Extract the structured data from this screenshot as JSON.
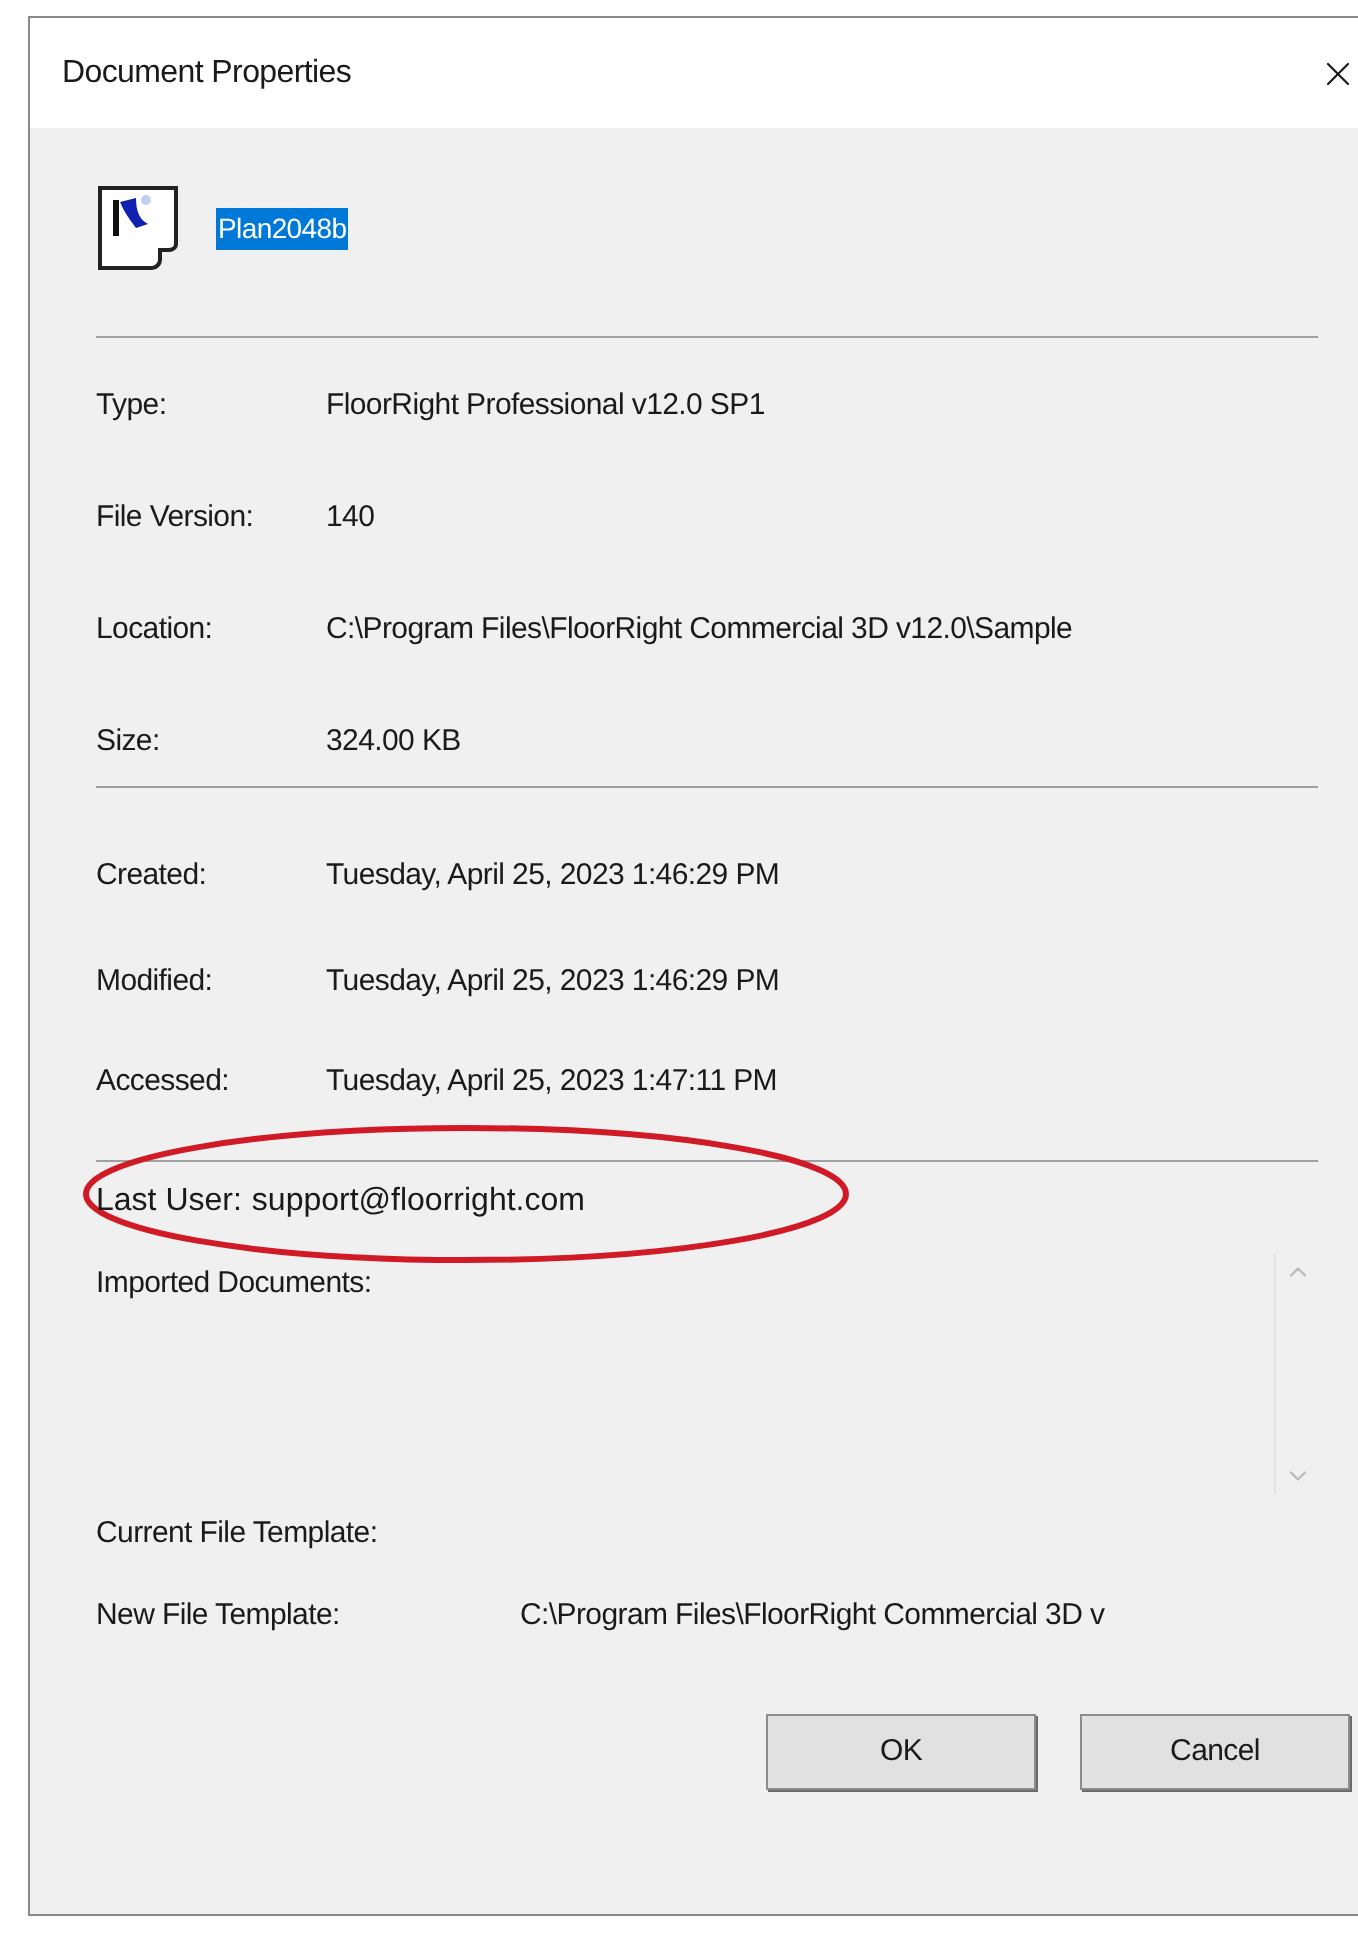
{
  "window": {
    "title": "Document Properties"
  },
  "document": {
    "name": "Plan2048b",
    "selected": true
  },
  "general": [
    {
      "label": "Type:",
      "value": "FloorRight Professional v12.0 SP1"
    },
    {
      "label": "File Version:",
      "value": "140"
    },
    {
      "label": "Location:",
      "value": "C:\\Program Files\\FloorRight Commercial 3D v12.0\\Sample"
    },
    {
      "label": "Size:",
      "value": "324.00 KB"
    }
  ],
  "dates": [
    {
      "label": "Created:",
      "value": "Tuesday, April 25, 2023 1:46:29 PM"
    },
    {
      "label": "Modified:",
      "value": "Tuesday, April 25, 2023 1:46:29 PM"
    },
    {
      "label": "Accessed:",
      "value": "Tuesday, April 25, 2023 1:47:11 PM"
    }
  ],
  "last_user": {
    "label": "Last User:",
    "value": "support@floorright.com",
    "highlighted": true
  },
  "imported_documents": {
    "label": "Imported Documents:"
  },
  "templates": [
    {
      "label": "Current File Template:"
    },
    {
      "label": "New File Template:",
      "value": "C:\\Program Files\\FloorRight Commercial 3D v"
    }
  ],
  "buttons": [
    {
      "label": "OK"
    },
    {
      "label": "Cancel"
    }
  ]
}
